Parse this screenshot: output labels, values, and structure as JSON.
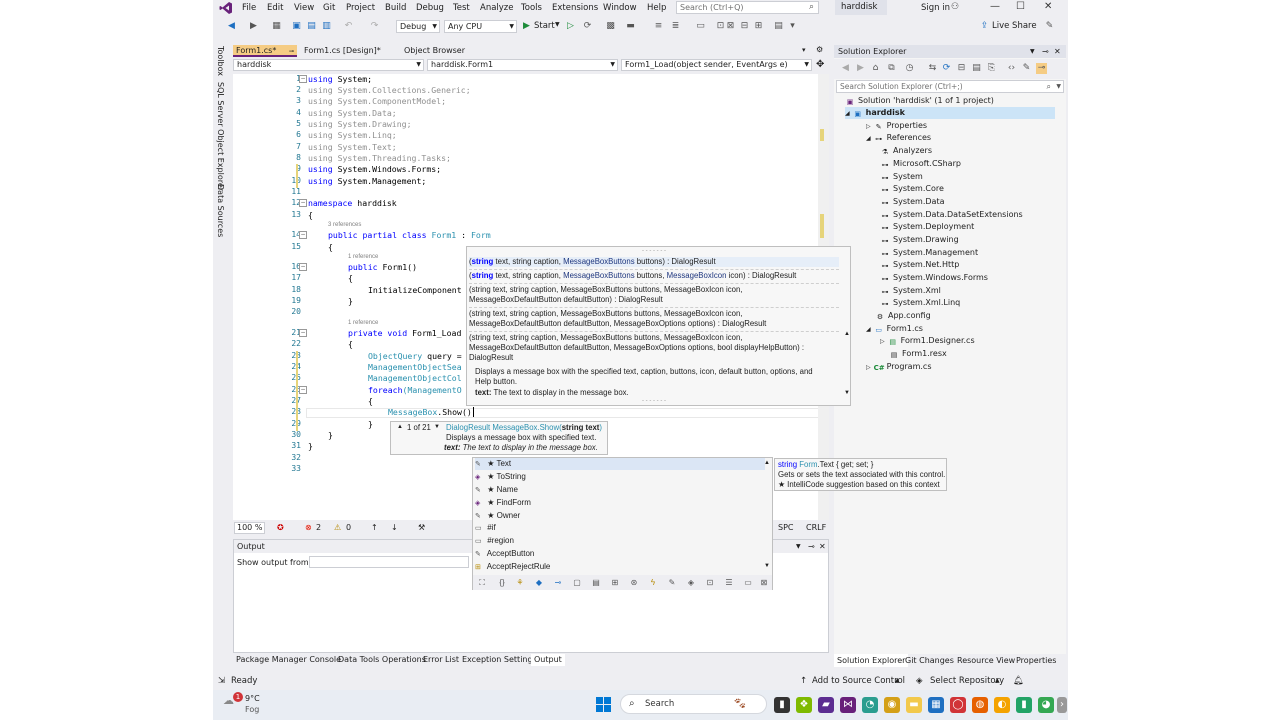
{
  "app": {
    "menu": [
      "File",
      "Edit",
      "View",
      "Git",
      "Project",
      "Build",
      "Debug",
      "Test",
      "Analyze",
      "Tools",
      "Extensions",
      "Window",
      "Help"
    ],
    "search_placeholder": "Search (Ctrl+Q)",
    "solution_name": "harddisk",
    "sign_in": "Sign in",
    "live_share": "Live Share",
    "config": "Debug",
    "platform": "Any CPU",
    "start": "Start",
    "side_tools": [
      "Toolbox",
      "SQL Server Object Explorer",
      "Data Sources"
    ]
  },
  "editor": {
    "tabs": [
      {
        "label": "Form1.cs*"
      },
      {
        "label": "Form1.cs [Design]*"
      },
      {
        "label": "Object Browser"
      }
    ],
    "nav": {
      "project": "harddisk",
      "type": "harddisk.Form1",
      "member": "Form1_Load(object sender, EventArgs e)"
    },
    "line_numbers": [
      "1",
      "2",
      "3",
      "4",
      "5",
      "6",
      "7",
      "8",
      "9",
      "10",
      "11",
      "12",
      "13",
      "14",
      "15",
      "16",
      "17",
      "18",
      "19",
      "20",
      "21",
      "22",
      "23",
      "24",
      "25",
      "26",
      "27",
      "28",
      "29",
      "30",
      "31",
      "32",
      "33"
    ],
    "codelens": {
      "class_refs": "3 references",
      "ctor_refs": "1 reference",
      "load_refs": "1 reference"
    },
    "code": {
      "l1_kw": "using",
      "l1_rest": " System;",
      "l2": "using System.Collections.Generic;",
      "l3": "using System.ComponentModel;",
      "l4": "using System.Data;",
      "l5": "using System.Drawing;",
      "l6": "using System.Linq;",
      "l7": "using System.Text;",
      "l8": "using System.Threading.Tasks;",
      "l9_kw": "using",
      "l9_rest": " System.Windows.Forms;",
      "l10_kw": "using",
      "l10_rest": " System.Management;",
      "l12_kw": "namespace",
      "l12_rest": " harddisk",
      "l13": "{",
      "l14_kw": "public partial class",
      "l14_type": "Form1",
      "l14_sep": " : ",
      "l14_base": "Form",
      "l15": "{",
      "l16_kw": "public",
      "l16_rest": " Form1()",
      "l17": "{",
      "l18": "InitializeComponent",
      "l19": "}",
      "l21_kw": "private void",
      "l21_rest": " Form1_Load",
      "l22": "{",
      "l23_type": "ObjectQuery",
      "l23_rest": " query =",
      "l24": "ManagementObjectSea",
      "l25": "ManagementObjectCol",
      "l26_kw": "foreach",
      "l26_rest": "(ManagementO",
      "l27": "{",
      "l28_type": "MessageBox",
      "l28_rest": ".Show()",
      "l29": "}",
      "l30": "}",
      "l31": "}",
      "l32": "}"
    },
    "zoom": "100 %",
    "errors": "2",
    "warnings": "0",
    "encoding": "SPC",
    "line_ending": "CRLF"
  },
  "signature_help": {
    "overloads": [
      {
        "parts": [
          "(",
          "string",
          " text, ",
          "string",
          " caption, ",
          "MessageBoxButtons",
          " buttons) : DialogResult"
        ]
      },
      {
        "parts": [
          "(",
          "string",
          " text, ",
          "string",
          " caption, ",
          "MessageBoxButtons",
          " buttons, ",
          "MessageBoxIcon",
          " icon) : DialogResult"
        ]
      },
      {
        "line1": "(string text, string caption, MessageBoxButtons buttons, MessageBoxIcon icon,",
        "line2": "MessageBoxDefaultButton defaultButton) : DialogResult"
      },
      {
        "line1": "(string text, string caption, MessageBoxButtons buttons, MessageBoxIcon icon,",
        "line2": "MessageBoxDefaultButton defaultButton, MessageBoxOptions options) : DialogResult"
      },
      {
        "line1": "(string text, string caption, MessageBoxButtons buttons, MessageBoxIcon icon,",
        "line2": "MessageBoxDefaultButton defaultButton, MessageBoxOptions options, bool displayHelpButton) :",
        "line3": "DialogResult"
      }
    ],
    "description": "Displays a message box with the specified text, caption, buttons, icon, default button, options, and Help button.",
    "param_name": "text:",
    "param_desc": " The text to display in the message box."
  },
  "param_tooltip": {
    "counter": "1 of 21",
    "signature_prefix": "DialogResult MessageBox.Show(",
    "signature_param": "string text",
    "signature_suffix": ")",
    "description": "Displays a message box with specified text.",
    "param_name": "text:",
    "param_desc": " The text to display in the message box."
  },
  "completion": {
    "items": [
      {
        "label": "★ Text",
        "icon": "wrench"
      },
      {
        "label": "★ ToString",
        "icon": "method"
      },
      {
        "label": "★ Name",
        "icon": "wrench"
      },
      {
        "label": "★ FindForm",
        "icon": "method"
      },
      {
        "label": "★ Owner",
        "icon": "wrench"
      },
      {
        "label": "#if",
        "icon": "snippet"
      },
      {
        "label": "#region",
        "icon": "snippet"
      },
      {
        "label": "AcceptButton",
        "icon": "wrench"
      },
      {
        "label": "AcceptRejectRule",
        "icon": "enum"
      }
    ]
  },
  "quick_info": {
    "line1_kw": "string",
    "line1_type": "Form",
    ".": ".",
    "line1_rest": ".Text { get; set; }",
    "line2": "Gets or sets the text associated with this control.",
    "line3": "★  IntelliCode suggestion based on this context"
  },
  "output": {
    "title": "Output",
    "show_from": "Show output from:"
  },
  "bottom_tabs": [
    "Package Manager Console",
    "Data Tools Operations",
    "Error List",
    "Exception Settings",
    "Output"
  ],
  "solution_explorer": {
    "title": "Solution Explorer",
    "search_placeholder": "Search Solution Explorer (Ctrl+;)",
    "items": [
      {
        "label": "Solution 'harddisk' (1 of 1 project)",
        "icon": "solution"
      },
      {
        "label": "harddisk",
        "icon": "project"
      },
      {
        "label": "Properties",
        "icon": "wrench"
      },
      {
        "label": "References",
        "icon": "refs"
      },
      {
        "label": "Analyzers",
        "icon": "analyzer"
      },
      {
        "label": "Microsoft.CSharp",
        "icon": "ref"
      },
      {
        "label": "System",
        "icon": "ref"
      },
      {
        "label": "System.Core",
        "icon": "ref"
      },
      {
        "label": "System.Data",
        "icon": "ref"
      },
      {
        "label": "System.Data.DataSetExtensions",
        "icon": "ref"
      },
      {
        "label": "System.Deployment",
        "icon": "ref"
      },
      {
        "label": "System.Drawing",
        "icon": "ref"
      },
      {
        "label": "System.Management",
        "icon": "ref"
      },
      {
        "label": "System.Net.Http",
        "icon": "ref"
      },
      {
        "label": "System.Windows.Forms",
        "icon": "ref"
      },
      {
        "label": "System.Xml",
        "icon": "ref"
      },
      {
        "label": "System.Xml.Linq",
        "icon": "ref"
      },
      {
        "label": "App.config",
        "icon": "config"
      },
      {
        "label": "Form1.cs",
        "icon": "form"
      },
      {
        "label": "Form1.Designer.cs",
        "icon": "cs"
      },
      {
        "label": "Form1.resx",
        "icon": "resx"
      },
      {
        "label": "Program.cs",
        "icon": "cs"
      }
    ],
    "tabs": [
      "Solution Explorer",
      "Git Changes",
      "Resource View",
      "Properties"
    ]
  },
  "status": {
    "ready": "Ready",
    "source_control": "Add to Source Control",
    "repository": "Select Repository"
  },
  "taskbar": {
    "temp": "9°C",
    "weather": "Fog",
    "badge": "1",
    "search": "Search"
  },
  "colors": {
    "accent": "#68217a",
    "keyword": "#0000ff",
    "type": "#2b91af",
    "tab_active": "#f5cc84"
  }
}
